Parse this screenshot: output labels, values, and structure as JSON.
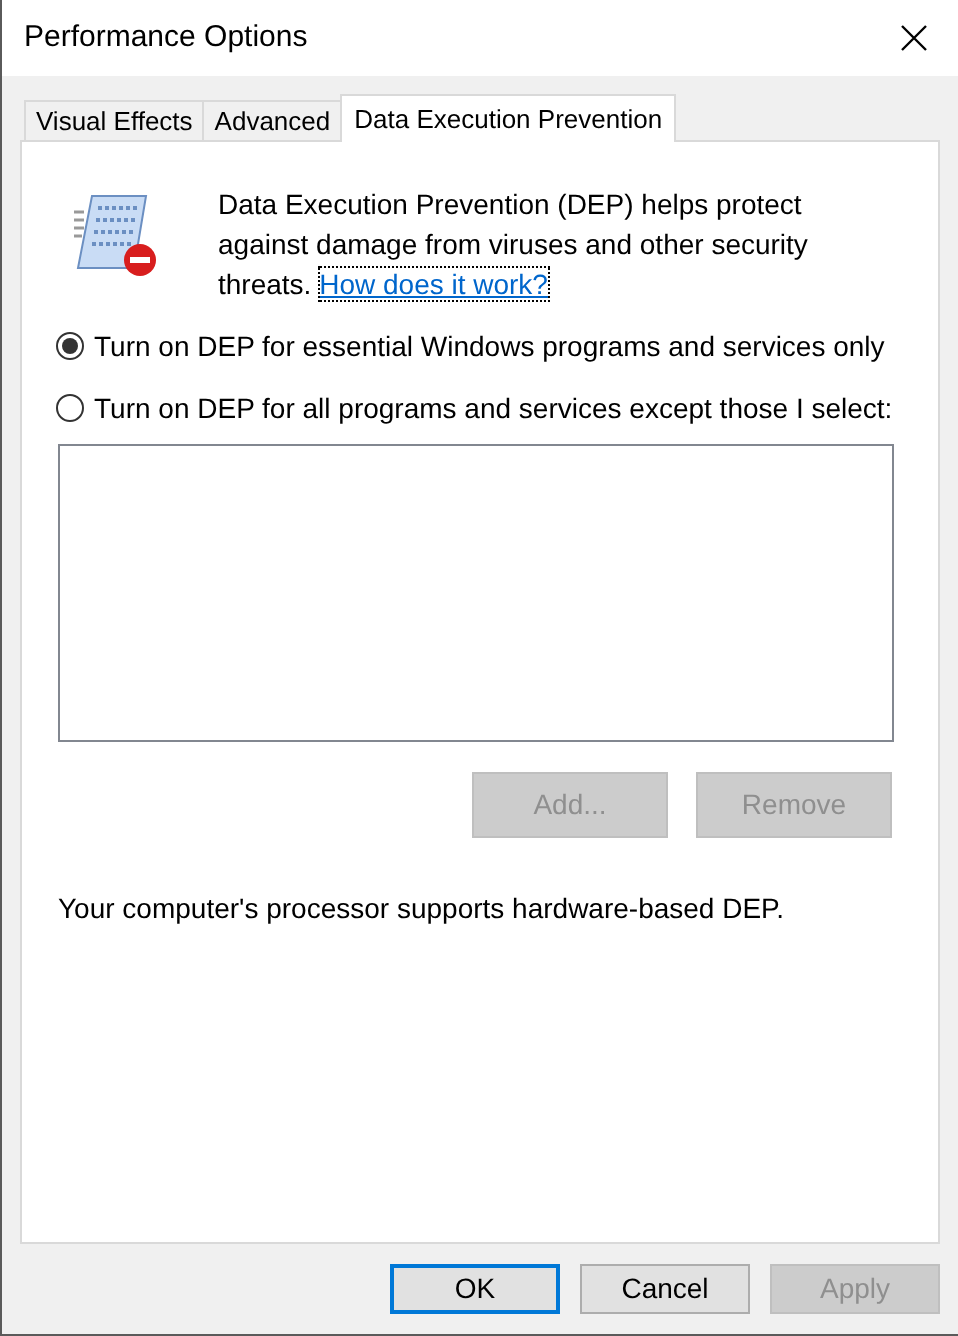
{
  "window": {
    "title": "Performance Options"
  },
  "tabs": [
    {
      "label": "Visual Effects",
      "selected": false
    },
    {
      "label": "Advanced",
      "selected": false
    },
    {
      "label": "Data Execution Prevention",
      "selected": true
    }
  ],
  "description": {
    "text": "Data Execution Prevention (DEP) helps protect against damage from viruses and other security threats.",
    "link": "How does it work?"
  },
  "options": [
    {
      "label": "Turn on DEP for essential Windows programs and services only",
      "selected": true
    },
    {
      "label": "Turn on DEP for all programs and services except those I select:",
      "selected": false
    }
  ],
  "list_buttons": [
    {
      "label": "Add...",
      "disabled": true
    },
    {
      "label": "Remove",
      "disabled": true
    }
  ],
  "processor_note": "Your computer's processor supports hardware-based DEP.",
  "dialog_buttons": [
    {
      "label": "OK",
      "disabled": false,
      "default": true
    },
    {
      "label": "Cancel",
      "disabled": false,
      "default": false
    },
    {
      "label": "Apply",
      "disabled": true,
      "default": false
    }
  ]
}
